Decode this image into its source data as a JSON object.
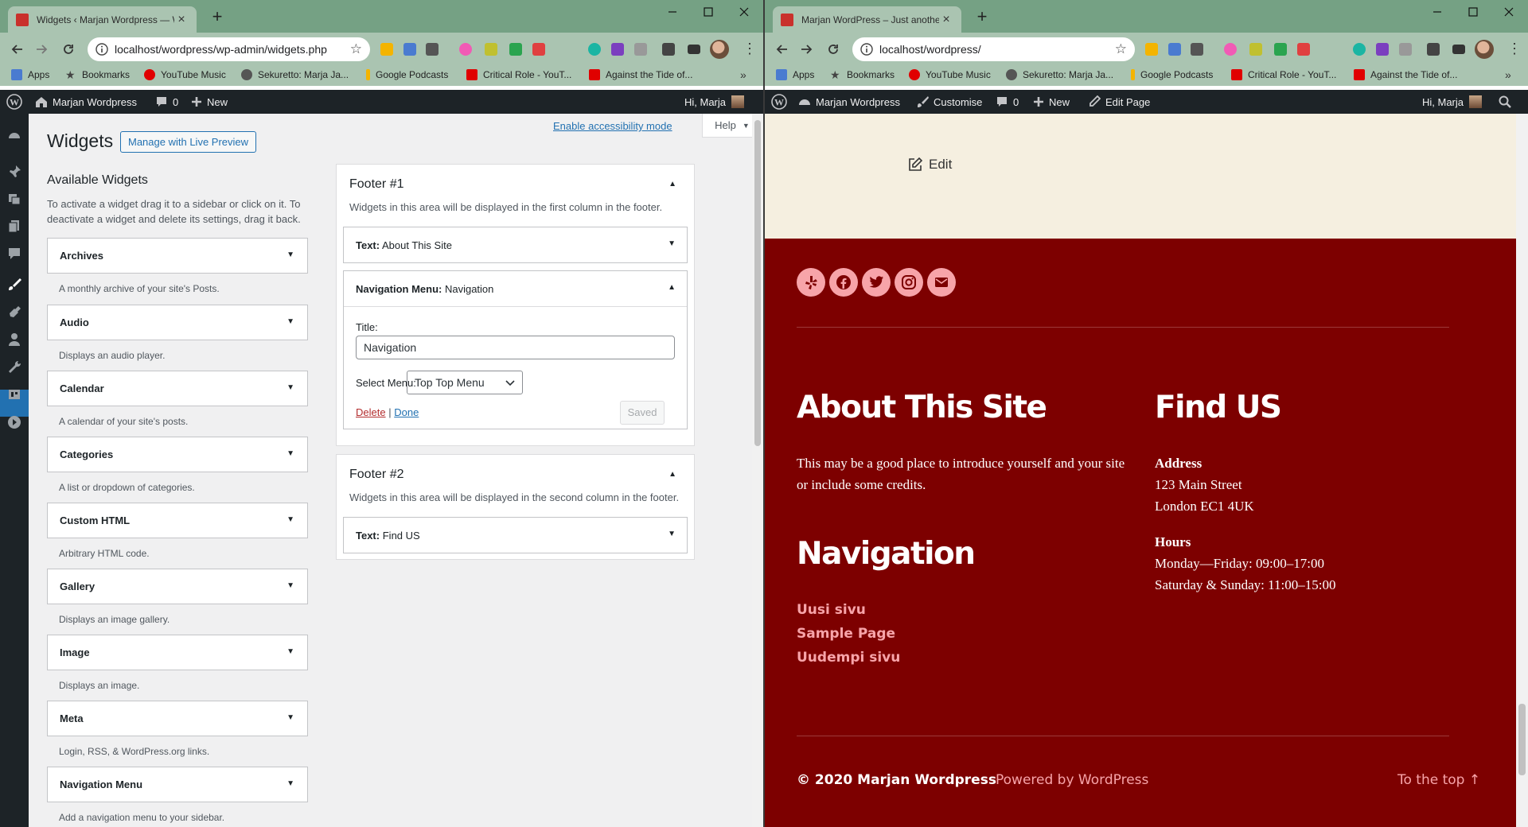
{
  "left_window": {
    "tab": {
      "title": "Widgets ‹ Marjan Wordpress — WordPress",
      "favicon_color": "#c9312c"
    },
    "url": "localhost/wordpress/wp-admin/widgets.php",
    "admin_bar": {
      "site_name": "Marjan Wordpress",
      "comments": "0",
      "new": "New",
      "greeting": "Hi, Marja"
    },
    "page": {
      "title": "Widgets",
      "preview_button": "Manage with Live Preview",
      "accessibility_link": "Enable accessibility mode",
      "help": "Help",
      "available_title": "Available Widgets",
      "available_desc": "To activate a widget drag it to a sidebar or click on it. To deactivate a widget and delete its settings, drag it back.",
      "widgets": [
        {
          "name": "Archives",
          "desc": "A monthly archive of your site's Posts."
        },
        {
          "name": "Audio",
          "desc": "Displays an audio player."
        },
        {
          "name": "Calendar",
          "desc": "A calendar of your site's posts."
        },
        {
          "name": "Categories",
          "desc": "A list or dropdown of categories."
        },
        {
          "name": "Custom HTML",
          "desc": "Arbitrary HTML code."
        },
        {
          "name": "Gallery",
          "desc": "Displays an image gallery."
        },
        {
          "name": "Image",
          "desc": "Displays an image."
        },
        {
          "name": "Meta",
          "desc": "Login, RSS, & WordPress.org links."
        },
        {
          "name": "Navigation Menu",
          "desc": "Add a navigation menu to your sidebar."
        }
      ],
      "footer1": {
        "title": "Footer #1",
        "desc": "Widgets in this area will be displayed in the first column in the footer.",
        "text_widget": {
          "type": "Text:",
          "name": "About This Site"
        },
        "nav_widget": {
          "type": "Navigation Menu:",
          "name": "Navigation",
          "title_label": "Title:",
          "title_value": "Navigation",
          "menu_label": "Select Menu:",
          "menu_value": "Top Top Menu",
          "delete": "Delete",
          "sep": "|",
          "done": "Done",
          "saved": "Saved"
        }
      },
      "footer2": {
        "title": "Footer #2",
        "desc": "Widgets in this area will be displayed in the second column in the footer.",
        "text_widget": {
          "type": "Text:",
          "name": "Find US"
        }
      }
    }
  },
  "right_window": {
    "tab": {
      "title": "Marjan WordPress – Just another WordPress site",
      "favicon_color": "#c9312c"
    },
    "url": "localhost/wordpress/",
    "admin_bar": {
      "site_name": "Marjan Wordpress",
      "customise": "Customise",
      "comments": "0",
      "new": "New",
      "edit_page": "Edit Page",
      "greeting": "Hi, Marja"
    },
    "edit_link": "Edit",
    "footer": {
      "about_heading": "About This Site",
      "about_text": "This may be a good place to introduce yourself and your site or include some credits.",
      "nav_heading": "Navigation",
      "nav_links": [
        "Uusi sivu",
        "Sample Page",
        "Uudempi sivu"
      ],
      "find_heading": "Find US",
      "address_label": "Address",
      "address_line1": "123 Main Street",
      "address_line2": "London EC1 4UK",
      "hours_label": "Hours",
      "hours_line1": "Monday—Friday: 09:00–17:00",
      "hours_line2": "Saturday & Sunday: 11:00–15:00",
      "copyright": "© 2020 Marjan Wordpress",
      "powered": "Powered by WordPress",
      "to_top": "To the top ↑"
    },
    "social_icons": [
      "yelp-icon",
      "facebook-icon",
      "twitter-icon",
      "instagram-icon",
      "mail-icon"
    ]
  },
  "bookmarks": [
    {
      "label": "Apps",
      "color": "#4a7bd0"
    },
    {
      "label": "Bookmarks",
      "color": "#444444"
    },
    {
      "label": "YouTube Music",
      "color": "#e00000"
    },
    {
      "label": "Sekuretto: Marja Ja...",
      "color": "#555555"
    },
    {
      "label": "Google Podcasts",
      "color": "#f4b400"
    },
    {
      "label": "Critical Role - YouT...",
      "color": "#e00000"
    },
    {
      "label": "Against the Tide of...",
      "color": "#e00000"
    }
  ],
  "colors": {
    "browser_frame": "#75a184",
    "toolbar": "#aac4b1",
    "wp_admin_dark": "#1d2327",
    "wp_blue": "#2271b1",
    "site_footer_bg": "#7d0000",
    "site_accent": "#f7a4a9",
    "site_top_bg": "#f5efe0"
  }
}
